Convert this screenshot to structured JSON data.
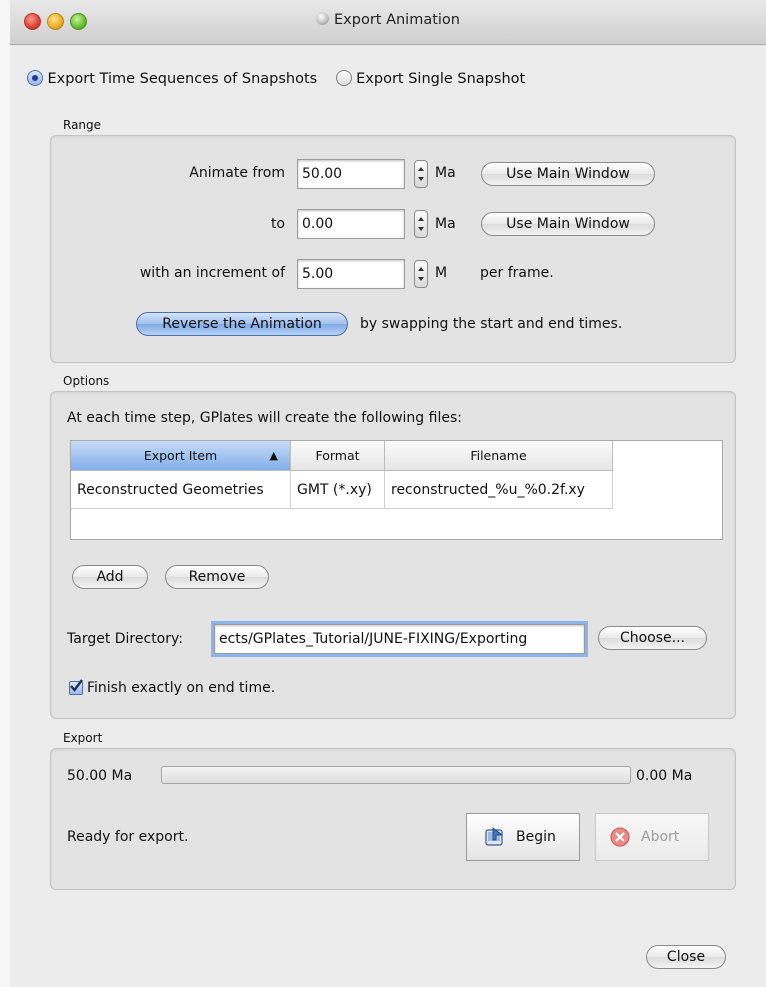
{
  "window": {
    "title": "Export Animation"
  },
  "mode": {
    "sequence_label": "Export Time Sequences of Snapshots",
    "single_label": "Export Single Snapshot",
    "selected": "sequence"
  },
  "range": {
    "section_label": "Range",
    "animate_from_label": "Animate from",
    "from_value": "50.00",
    "from_unit": "Ma",
    "to_label": "to",
    "to_value": "0.00",
    "to_unit": "Ma",
    "increment_label": "with an increment of",
    "increment_value": "5.00",
    "increment_unit": "M",
    "per_frame_label": "per frame.",
    "use_main_window_label": "Use Main Window",
    "reverse_button_label": "Reverse the Animation",
    "reverse_note": "by swapping the start and end times."
  },
  "options": {
    "section_label": "Options",
    "intro_text": "At each time step, GPlates will create the following files:",
    "columns": [
      "Export Item",
      "Format",
      "Filename"
    ],
    "sort_indicator": "▲",
    "rows": [
      {
        "export_item": "Reconstructed Geometries",
        "format": "GMT (*.xy)",
        "filename": "reconstructed_%u_%0.2f.xy"
      }
    ],
    "add_label": "Add",
    "remove_label": "Remove",
    "target_dir_label": "Target Directory:",
    "target_dir_value": "ects/GPlates_Tutorial/JUNE-FIXING/Exporting",
    "choose_label": "Choose...",
    "finish_label": "Finish exactly on end time.",
    "finish_checked": true
  },
  "export": {
    "section_label": "Export",
    "start_label": "50.00 Ma",
    "end_label": "0.00 Ma",
    "progress_fraction": 0,
    "status": "Ready for export.",
    "begin_label": "Begin",
    "abort_label": "Abort"
  },
  "footer": {
    "close_label": "Close"
  },
  "colors": {
    "selection_blue": "#81aee9",
    "abort_red": "#d9473f"
  }
}
